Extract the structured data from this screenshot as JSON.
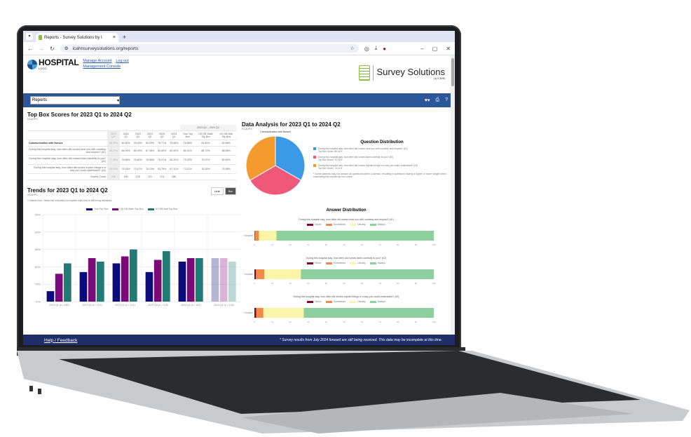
{
  "browser": {
    "tab_title": "Reports - Survey Solutions by I",
    "url": "icahnsurveysolutions.org/reports"
  },
  "header": {
    "logo_text": "HOSPITAL",
    "logo_sub": "LOGO",
    "links": [
      "Manage Account",
      "Log out",
      "Management Console"
    ],
    "brand_name": "Survey Solutions",
    "brand_by": "by ICAHN"
  },
  "toolbar": {
    "select_value": "Reports",
    "icons": [
      "heart-icon",
      "print-icon",
      "help-icon"
    ]
  },
  "top_box": {
    "title": "Top Box Scores for 2023 Q1 to 2024 Q2",
    "subtitle": "HCAHPS",
    "span_header": "2023 Q1 – 2024 Q2",
    "columns": [
      "2024 Q2*",
      "2024 Q1",
      "2023 Q4",
      "2023 Q3",
      "2023 Q2",
      "2023 Q1",
      "Your Top Box",
      "US DB State Top Box",
      "US DB Natl Top Box"
    ],
    "rows": [
      {
        "label": "Communication with Nurses",
        "category": true,
        "values": [
          "83.00%",
          "80.60%",
          "78.00%",
          "80.03%",
          "78.71%",
          "75.08%",
          "78.88%",
          "81.50%",
          "82.88%"
        ]
      },
      {
        "label": "During this hospital stay, how often did nurses treat you with courtesy and respect? (#1)",
        "category": false,
        "values": [
          "88.77%",
          "85.09%",
          "85.00%",
          "87.08%",
          "83.00%",
          "82.09%",
          "86.31%",
          "88.72%",
          "88.58%"
        ]
      },
      {
        "label": "During this hospital stay, how often did nurses listen carefully to you? (#2)",
        "category": false,
        "values": [
          "77.96%",
          "75.88%",
          "75.60%",
          "76.56%",
          "76.01%",
          "66.20%",
          "75.32%",
          "79.07%",
          "80.62%"
        ]
      },
      {
        "label": "During this hospital stay, how often did nurses explain things in a way you could understand? (#3)",
        "category": false,
        "values": [
          "80.00%",
          "78.18%",
          "73.17%",
          "76.13%",
          "63.78%",
          "67.31%",
          "73.11%",
          "76.39%",
          "76.98%"
        ]
      },
      {
        "label": "Survey Count",
        "category": false,
        "values": [
          "135",
          "150",
          "125",
          "101",
          "174",
          "180",
          "",
          "",
          ""
        ]
      }
    ]
  },
  "trends": {
    "title": "Trends for 2023 Q1 to 2024 Q2",
    "subtitle": "HCAHPS",
    "note": "* Dashed line / faded bar indicates incomplete data that is still being tabulated.",
    "toggle": [
      "Line",
      "Bar"
    ],
    "toggle_active": "Bar"
  },
  "chart_data": [
    {
      "type": "bar",
      "title": "",
      "xlabel": "",
      "ylabel": "",
      "ylim": [
        70,
        95
      ],
      "yticks": [
        "70%",
        "75%",
        "80%",
        "85%",
        "90%",
        "95%"
      ],
      "grid": true,
      "legend": "top",
      "categories": [
        "2023 Q1 (n = 180)",
        "2023 Q2 (n = 174)",
        "2023 Q3 (n = 101)",
        "2023 Q4 (n = 125)",
        "2024 Q1 (n = 167)",
        "2024 Q2 (n = 135)"
      ],
      "series": [
        {
          "name": "Your Top Box",
          "color": "#0b0b7a",
          "values": [
            73.0,
            78.5,
            81.0,
            78.5,
            81.5,
            82.5
          ]
        },
        {
          "name": "US DB State Top Box",
          "color": "#7a0a7a",
          "values": [
            78.0,
            82.5,
            83.0,
            82.0,
            82.5,
            82.5
          ]
        },
        {
          "name": "US DB Natl Top Box",
          "color": "#217a74",
          "values": [
            81.0,
            81.5,
            85.0,
            84.5,
            82.5,
            81.5
          ]
        }
      ],
      "incomplete_category": "2024 Q2 (n = 135)"
    },
    {
      "type": "pie",
      "title": "Communication with Nurses",
      "legend": "right",
      "categories": [
        "Courtesy and respect (#1)",
        "Listen carefully (#2)",
        "Explain things (#3)"
      ],
      "values": [
        33.3,
        33.3,
        33.4
      ],
      "colors": [
        "#3b9ae6",
        "#f0587a",
        "#f59a2f"
      ]
    },
    {
      "type": "bar",
      "orientation": "horizontal-stacked",
      "title": "During this hospital stay, how often did nurses treat you with courtesy and respect? (#1)",
      "categories": [
        "Hospital"
      ],
      "xlim": [
        0,
        100
      ],
      "xticks": [
        0,
        10,
        20,
        30,
        40,
        50,
        60,
        70,
        80,
        90,
        100
      ],
      "series": [
        {
          "name": "Never",
          "color": "#7a0a24",
          "values": [
            0.2
          ]
        },
        {
          "name": "Sometimes",
          "color": "#f08a46",
          "values": [
            2.3
          ]
        },
        {
          "name": "Usually",
          "color": "#faf5a8",
          "values": [
            9.8
          ]
        },
        {
          "name": "Always",
          "color": "#8ecf9f",
          "values": [
            87.7
          ]
        }
      ]
    },
    {
      "type": "bar",
      "orientation": "horizontal-stacked",
      "title": "During this hospital stay, how often did nurses listen carefully to you? (#2)",
      "categories": [
        "Hospital"
      ],
      "xlim": [
        0,
        100
      ],
      "xticks": [
        0,
        10,
        20,
        30,
        40,
        50,
        60,
        70,
        80,
        90,
        100
      ],
      "series": [
        {
          "name": "Never",
          "color": "#7a0a24",
          "values": [
            0.9
          ]
        },
        {
          "name": "Sometimes",
          "color": "#f08a46",
          "values": [
            4.6
          ]
        },
        {
          "name": "Usually",
          "color": "#faf5a8",
          "values": [
            20.4
          ]
        },
        {
          "name": "Always",
          "color": "#8ecf9f",
          "values": [
            74.1
          ]
        }
      ]
    },
    {
      "type": "bar",
      "orientation": "horizontal-stacked",
      "title": "During this hospital stay, how often did nurses explain things in a way you could understand? (#3)",
      "categories": [
        "Hospital"
      ],
      "xlim": [
        0,
        100
      ],
      "xticks": [
        0,
        10,
        20,
        30,
        40,
        50,
        60,
        70,
        80,
        90,
        100
      ],
      "series": [
        {
          "name": "Never",
          "color": "#7a0a24",
          "values": [
            1.0
          ]
        },
        {
          "name": "Sometimes",
          "color": "#f08a46",
          "values": [
            4.0
          ]
        },
        {
          "name": "Usually",
          "color": "#faf5a8",
          "values": [
            22.5
          ]
        },
        {
          "name": "Always",
          "color": "#8ecf9f",
          "values": [
            72.5
          ]
        }
      ]
    }
  ],
  "analysis": {
    "title": "Data Analysis for 2023 Q1 to 2024 Q2",
    "subtitle": "HCAHPS",
    "pie_title": "Communication with Nurses",
    "qd_title": "Question Distribution",
    "qd_items": [
      {
        "text": "During this hospital stay, how often did nurses treat you with courtesy and respect? (#1)",
        "score": "Top Box Score: 86.31%"
      },
      {
        "text": "During this hospital stay, how often did nurses listen carefully to you? (#2)",
        "score": "Top Box Score: 75.32%"
      },
      {
        "text": "During this hospital stay, how often did nurses explain things in a way you could understand? (#3)",
        "score": "Top Box Score: 73.11%"
      }
    ],
    "qd_note": "* Some patients may not answer all questions within a domain, resulting in questions having a higher or lower weight when calculating the overall top box score.",
    "ad_title": "Answer Distribution"
  },
  "footer": {
    "help": "Help / Feedback",
    "note": "* Survey results from July 2024 forward are still being received. This data may be incomplete at this time."
  }
}
